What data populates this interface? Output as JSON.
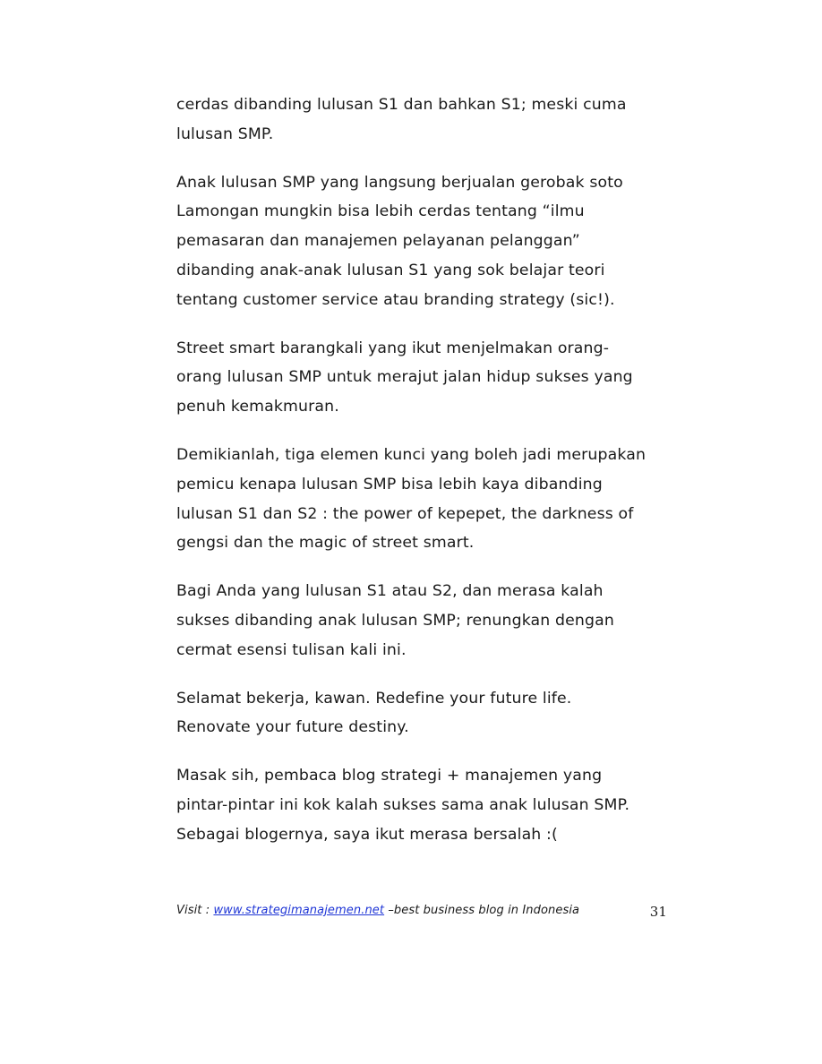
{
  "paragraphs": [
    [
      "cerdas dibanding lulusan S1 dan bahkan S1; meski cuma",
      "lulusan SMP."
    ],
    [
      "Anak lulusan SMP yang langsung berjualan gerobak soto",
      "Lamongan mungkin bisa lebih cerdas tentang “ilmu",
      "pemasaran dan manajemen pelayanan pelanggan”",
      "dibanding anak-anak lulusan S1 yang sok belajar teori",
      "tentang customer service atau branding strategy (sic!)."
    ],
    [
      "Street smart barangkali yang ikut menjelmakan orang-",
      "orang lulusan SMP untuk merajut jalan hidup sukses yang",
      "penuh kemakmuran."
    ],
    [
      "Demikianlah, tiga elemen kunci yang boleh jadi merupakan",
      "pemicu kenapa lulusan SMP bisa lebih kaya dibanding",
      "lulusan S1 dan S2 : the power of kepepet, the darkness of",
      "gengsi dan the magic of street smart."
    ],
    [
      "Bagi Anda yang lulusan S1 atau S2, dan merasa kalah",
      "sukses dibanding anak lulusan SMP; renungkan dengan",
      "cermat esensi tulisan kali ini."
    ],
    [
      "Selamat bekerja, kawan. Redefine your future life.",
      "Renovate your future destiny."
    ],
    [
      "Masak sih, pembaca blog strategi + manajemen yang",
      "pintar-pintar ini kok kalah sukses sama anak lulusan SMP.",
      "Sebagai blogernya, saya ikut merasa bersalah :("
    ]
  ],
  "footer": {
    "prefix": "Visit : ",
    "link_text": "www.strategimanajemen.net",
    "suffix": " –best business blog in Indonesia",
    "page_number": "31",
    "link_color": "#1f36d6"
  }
}
